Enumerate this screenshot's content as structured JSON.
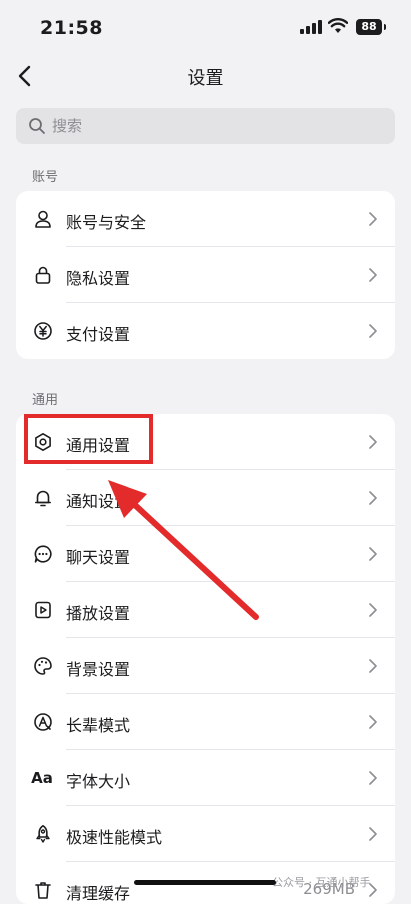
{
  "status_bar": {
    "time": "21:58",
    "battery": "88"
  },
  "nav": {
    "title": "设置"
  },
  "search": {
    "placeholder": "搜索"
  },
  "sections": [
    {
      "label": "账号",
      "items": [
        {
          "label": "账号与安全",
          "icon": "person-icon"
        },
        {
          "label": "隐私设置",
          "icon": "lock-icon"
        },
        {
          "label": "支付设置",
          "icon": "yen-icon"
        }
      ]
    },
    {
      "label": "通用",
      "items": [
        {
          "label": "通用设置",
          "icon": "gear-icon"
        },
        {
          "label": "通知设置",
          "icon": "bell-icon"
        },
        {
          "label": "聊天设置",
          "icon": "chat-bubble-icon"
        },
        {
          "label": "播放设置",
          "icon": "play-icon"
        },
        {
          "label": "背景设置",
          "icon": "palette-icon"
        },
        {
          "label": "长辈模式",
          "icon": "elder-mode-icon"
        },
        {
          "label": "字体大小",
          "icon": "font-size-icon",
          "glyph": "Aa"
        },
        {
          "label": "极速性能模式",
          "icon": "rocket-icon"
        },
        {
          "label": "清理缓存",
          "icon": "trash-icon",
          "value": "269MB"
        }
      ]
    }
  ],
  "watermark": "公众号 · 互通小帮手",
  "colors": {
    "highlight": "#e32b2b",
    "background": "#f2f2f4"
  }
}
